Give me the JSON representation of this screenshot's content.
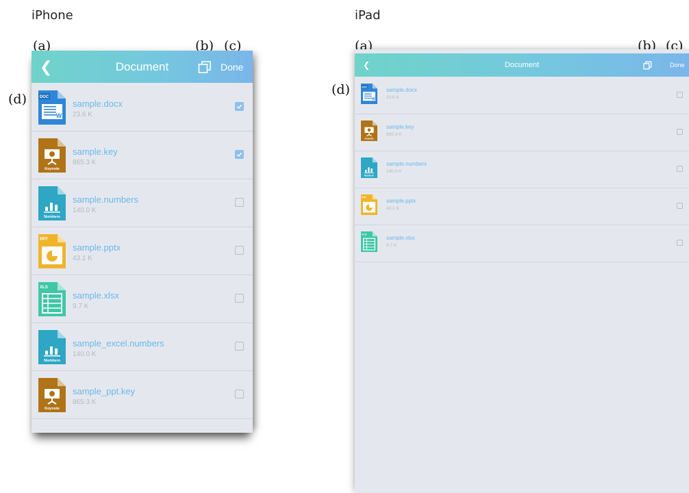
{
  "labels": {
    "iphone": "iPhone",
    "ipad": "iPad",
    "a": "(a)",
    "b": "(b)",
    "c": "(c)",
    "d": "(d)"
  },
  "iphone_screen": {
    "back_glyph": "❮",
    "title": "Document",
    "done_label": "Done",
    "files": [
      {
        "name": "sample.docx",
        "size": "23.6 K",
        "type": "doc",
        "checked": true
      },
      {
        "name": "sample.key",
        "size": "865.3 K",
        "type": "key",
        "checked": true
      },
      {
        "name": "sample.numbers",
        "size": "140.0 K",
        "type": "numbers",
        "checked": false
      },
      {
        "name": "sample.pptx",
        "size": "43.1 K",
        "type": "ppt",
        "checked": false
      },
      {
        "name": "sample.xlsx",
        "size": "9.7 K",
        "type": "xls",
        "checked": false
      },
      {
        "name": "sample_excel.numbers",
        "size": "140.0 K",
        "type": "numbers",
        "checked": false
      },
      {
        "name": "sample_ppt.key",
        "size": "865.3 K",
        "type": "key",
        "checked": false
      }
    ]
  },
  "ipad_screen": {
    "back_glyph": "❮",
    "title": "Document",
    "done_label": "Done",
    "files": [
      {
        "name": "sample.docx",
        "size": "23.6 K",
        "type": "doc",
        "checked": false
      },
      {
        "name": "sample.key",
        "size": "865.3 K",
        "type": "key",
        "checked": false
      },
      {
        "name": "sample.numbers",
        "size": "140.0 K",
        "type": "numbers",
        "checked": false
      },
      {
        "name": "sample.pptx",
        "size": "43.1 K",
        "type": "ppt",
        "checked": false
      },
      {
        "name": "sample.xlsx",
        "size": "9.7 K",
        "type": "xls",
        "checked": false
      }
    ]
  },
  "icon_labels": {
    "doc_badge": "DOC",
    "doc_letter": "W",
    "key_caption": "Keynote",
    "numbers_caption": "Numbers",
    "ppt_badge": "PPT",
    "xls_badge": "XLS"
  },
  "colors": {
    "nav_gradient_start": "#6fd3c9",
    "nav_gradient_end": "#7ab6ea",
    "file_name": "#6bb7ec",
    "file_size": "#b2b9c1",
    "list_bg": "#e4e8ee",
    "checkbox_on": "#8ec0ee",
    "doc_icon": "#2f86d6",
    "key_icon": "#b07317",
    "numbers_icon": "#2ea6c4",
    "ppt_icon": "#f0b42b",
    "xls_icon": "#3fc7a6"
  }
}
